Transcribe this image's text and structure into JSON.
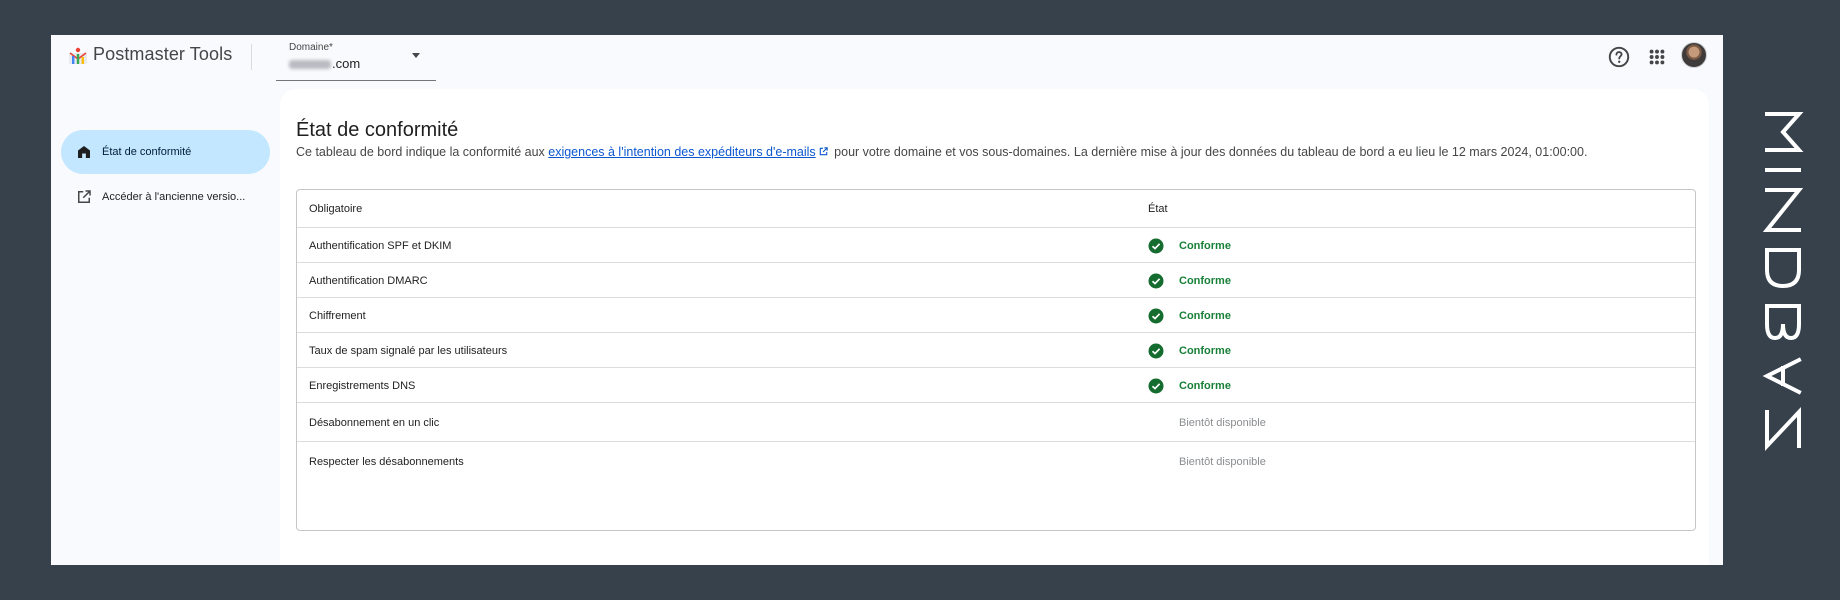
{
  "header": {
    "app_title": "Postmaster Tools",
    "domain_label": "Domaine*",
    "domain_value": ".com",
    "icons": [
      "logo-icon",
      "help-icon",
      "apps-grid-icon",
      "avatar"
    ]
  },
  "sidebar": {
    "items": [
      {
        "label": "État de conformité",
        "icon": "home-icon",
        "active": true
      },
      {
        "label": "Accéder à l'ancienne versio...",
        "icon": "open-in-new-icon",
        "active": false
      }
    ]
  },
  "main": {
    "title": "État de conformité",
    "description_before": "Ce tableau de bord indique la conformité aux ",
    "description_link": "exigences à l'intention des expéditeurs d'e-mails",
    "description_after": " pour votre domaine et vos sous-domaines. La dernière mise à jour des données du tableau de bord a eu lieu le 12 mars 2024, 01:00:00.",
    "table": {
      "headers": {
        "requirement": "Obligatoire",
        "status": "État"
      },
      "rows": [
        {
          "requirement": "Authentification SPF et DKIM",
          "status": "Conforme",
          "state": "ok"
        },
        {
          "requirement": "Authentification DMARC",
          "status": "Conforme",
          "state": "ok"
        },
        {
          "requirement": "Chiffrement",
          "status": "Conforme",
          "state": "ok"
        },
        {
          "requirement": "Taux de spam signalé par les utilisateurs",
          "status": "Conforme",
          "state": "ok"
        },
        {
          "requirement": "Enregistrements DNS",
          "status": "Conforme",
          "state": "ok"
        },
        {
          "requirement": "Désabonnement en un clic",
          "status": "Bientôt disponible",
          "state": "soon"
        },
        {
          "requirement": "Respecter les désabonnements",
          "status": "Bientôt disponible",
          "state": "soon"
        }
      ]
    }
  },
  "watermark": {
    "text": "MINDBAZ"
  },
  "colors": {
    "background": "#36414c",
    "active_nav": "#c2e7ff",
    "ok_green": "#188038",
    "link_blue": "#0b57d0",
    "muted_gray": "#8a8d90"
  }
}
